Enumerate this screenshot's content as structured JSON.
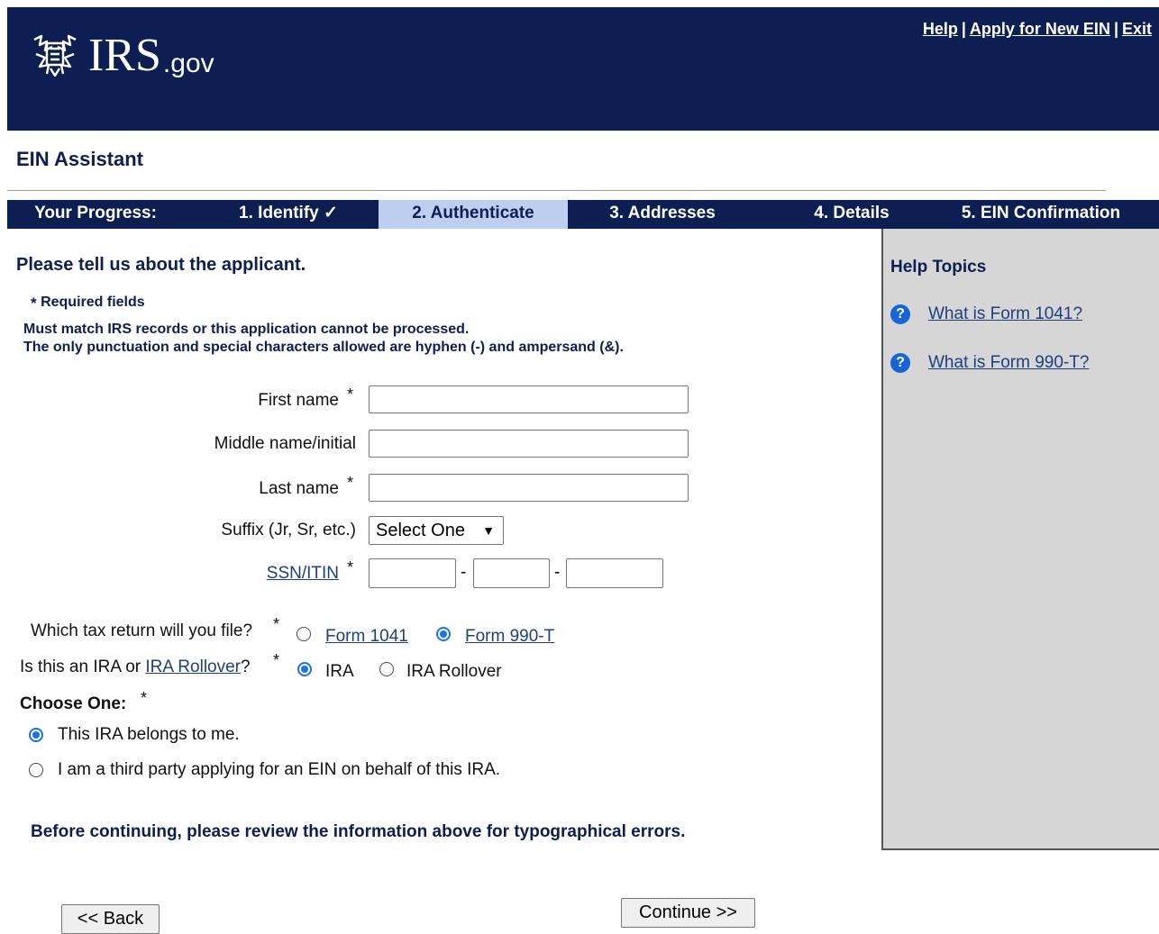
{
  "header": {
    "logo_text": "IRS",
    "logo_suffix": ".gov",
    "links": [
      "Help",
      "Apply for New EIN",
      "Exit"
    ],
    "separator": "|"
  },
  "app_title": "EIN Assistant",
  "progress": {
    "label": "Your Progress:",
    "steps": [
      "1. Identify ✓",
      "2. Authenticate",
      "3. Addresses",
      "4. Details",
      "5. EIN Confirmation"
    ],
    "active_step": "2. Authenticate"
  },
  "form": {
    "heading": "Please tell us about the applicant.",
    "required_star": "*",
    "required_label": "Required fields",
    "info_lines": [
      "Must match IRS records or this application cannot be processed.",
      "The only punctuation and special characters allowed are hyphen (-) and ampersand (&)."
    ],
    "first_name_label": "First name",
    "first_name_value": "",
    "middle_name_label": "Middle name/initial",
    "middle_name_value": "",
    "last_name_label": "Last name",
    "last_name_value": "",
    "suffix_label": "Suffix (Jr, Sr, etc.)",
    "suffix_selected": "Select One",
    "ssn_label": "SSN/ITIN",
    "ssn_separator": "-",
    "tax_return_question": "Which tax return will you file?",
    "tax_return_options": [
      "Form 1041",
      "Form 990-T"
    ],
    "tax_return_selected": "Form 990-T",
    "ira_question_prefix": "Is this an IRA or",
    "ira_question_link": "IRA Rollover",
    "ira_question_suffix": "?",
    "ira_options": [
      "IRA",
      "IRA Rollover"
    ],
    "ira_selected": "IRA",
    "choose_label": "Choose One:",
    "choose_options": [
      "This IRA belongs to me.",
      "I am a third party applying for an EIN on behalf of this IRA."
    ],
    "choose_selected": "This IRA belongs to me.",
    "review_text": "Before continuing, please review the information above for typographical errors.",
    "back_label": "<< Back",
    "continue_label": "Continue >>"
  },
  "help": {
    "title": "Help Topics",
    "links": [
      "What is Form 1041?",
      "What is Form 990-T?"
    ]
  },
  "colors": {
    "navy": "#0c1e52",
    "active_step_bg": "#bccff0",
    "help_panel_bg": "#d6d6d6",
    "link": "#1f3e7c",
    "radio_selected": "#1a73e8"
  }
}
